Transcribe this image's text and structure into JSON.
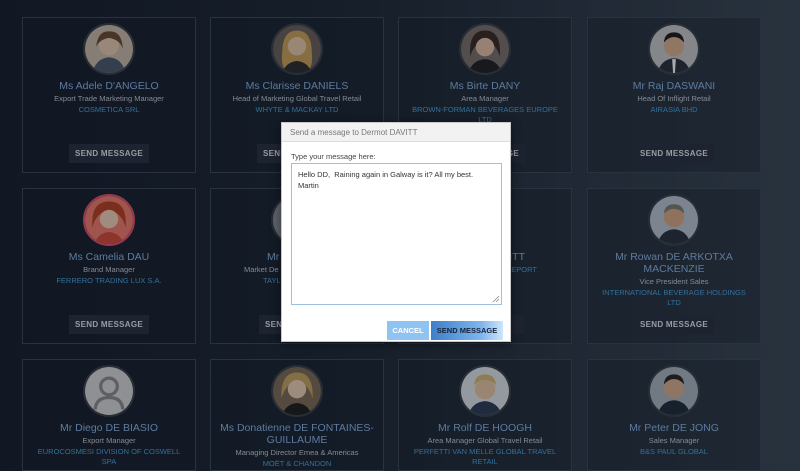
{
  "cards": [
    {
      "name": "Ms Adele D'ANGELO",
      "role": "Export Trade Marketing Manager",
      "company": "COSMETICA SRL",
      "button": "SEND MESSAGE",
      "avatar": "photo-woman-brown-hair"
    },
    {
      "name": "Ms Clarisse DANIELS",
      "role": "Head of Marketing Global Travel Retail",
      "company": "WHYTE & MACKAY LTD",
      "button": "SEND MESSAGE",
      "avatar": "photo-woman-blonde-hair"
    },
    {
      "name": "Ms Birte DANY",
      "role": "Area Manager",
      "company": "BROWN-FORMAN BEVERAGES EUROPE LTD",
      "button": "SEND MESSAGE",
      "avatar": "photo-woman-dark-hair"
    },
    {
      "name": "Mr Raj DASWANI",
      "role": "Head Of Inflight Retail",
      "company": "AIRASIA BHD",
      "button": "SEND MESSAGE",
      "avatar": "photo-man-dark-hair"
    },
    {
      "name": "Ms Camelia DAU",
      "role": "Brand Manager",
      "company": "FERRERO TRADING LUX S.A.",
      "button": "SEND MESSAGE",
      "avatar": "photo-woman-red-hair"
    },
    {
      "name": "Mr G",
      "role": "Market De",
      "company": "TAYL",
      "button": "SEND MESSAGE",
      "avatar": "photo-hidden"
    },
    {
      "name": "ITT",
      "role": "",
      "company": "EPORT",
      "button": "SEND MESSAGE",
      "avatar": "photo-hidden"
    },
    {
      "name": "Mr Rowan DE ARKOTXA MACKENZIE",
      "role": "Vice President Sales",
      "company": "INTERNATIONAL BEVERAGE HOLDINGS LTD",
      "button": "SEND MESSAGE",
      "avatar": "photo-man-grey-hair"
    },
    {
      "name": "Mr Diego DE BIASIO",
      "role": "Export Manager",
      "company": "EUROCOSMESI DIVISION OF COSWELL SPA",
      "button": "SEND MESSAGE",
      "avatar": "placeholder-person"
    },
    {
      "name": "Ms Donatienne DE FONTAINES-GUILLAUME",
      "role": "Managing Director Emea & Americas",
      "company": "MOËT & CHANDON",
      "button": "SEND MESSAGE",
      "avatar": "photo-woman-blonde-hair"
    },
    {
      "name": "Mr Rolf DE HOOGH",
      "role": "Area Manager Global Travel Retail",
      "company": "PERFETTI VAN MELLE GLOBAL TRAVEL RETAIL",
      "button": "SEND MESSAGE",
      "avatar": "photo-man-fair-hair"
    },
    {
      "name": "Mr Peter DE JONG",
      "role": "Sales Manager",
      "company": "B&S PAUL GLOBAL",
      "button": "SEND MESSAGE",
      "avatar": "photo-man-dark-hair"
    }
  ],
  "modal": {
    "title": "Send a message to Dermot DAVITT",
    "label": "Type your message here:",
    "message": "Hello DD,  Raining again in Galway is it? All my best.\nMartin",
    "cancel_label": "CANCEL",
    "send_label": "SEND MESSAGE"
  },
  "colors": {
    "name": "#8ab4e6",
    "company": "#4aa3df",
    "cancel_button": "#8fc4f2",
    "send_button": "#3f7fc9"
  }
}
